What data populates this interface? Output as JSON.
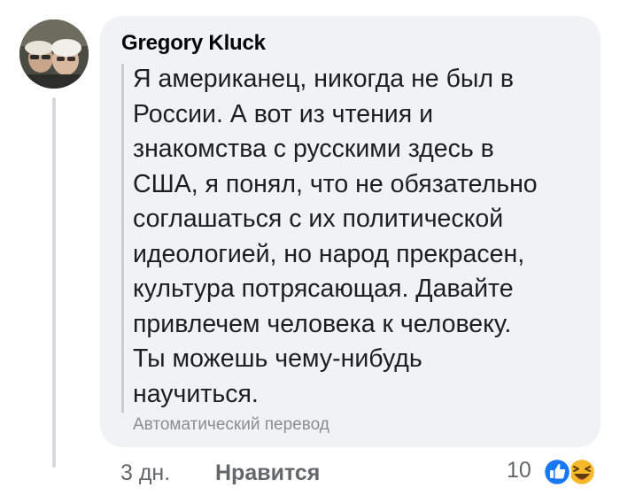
{
  "comment": {
    "author": "Gregory Kluck",
    "text": "Я американец, никогда не был в\nРоссии. А вот из чтения и\nзнакомства с русскими здесь в\nСША, я понял, что не обязательно\nсоглашаться с их политической\nидеологией, но народ прекрасен,\nкультура потрясающая. Давайте\nпривлечем человека к человеку.\nТы можешь чему-нибудь\nнаучиться.",
    "translation_label": "Автоматический перевод"
  },
  "footer": {
    "time": "3 дн.",
    "like_label": "Нравится",
    "reaction_count": "10",
    "reaction_icons": [
      "like-icon",
      "haha-icon"
    ]
  },
  "colors": {
    "bubble": "#f0f2f5",
    "like_blue": "#1877f2",
    "haha_yellow": "#f7b928"
  }
}
